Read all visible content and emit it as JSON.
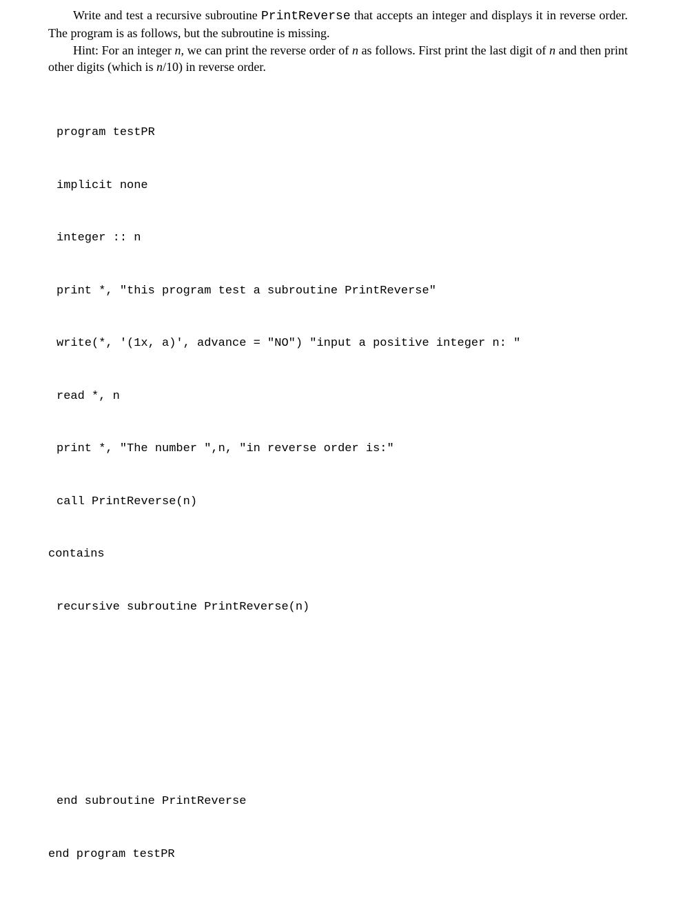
{
  "prose": {
    "p1_a": "Write and test a recursive subroutine ",
    "p1_code": "PrintReverse",
    "p1_b": " that accepts an integer and displays it in reverse order. The program is as follows, but the subroutine is missing.",
    "p2_a": "Hint: For an integer ",
    "p2_n1": "n",
    "p2_b": ", we can print the reverse order of ",
    "p2_n2": "n",
    "p2_c": " as follows. First print the last digit of ",
    "p2_n3": "n",
    "p2_d": " and then print other digits (which is ",
    "p2_n4": "n",
    "p2_e": "/10) in reverse order."
  },
  "code": {
    "l1": "program testPR",
    "l2": "implicit none",
    "l3": "integer :: n",
    "l4": "print *, \"this program test a subroutine PrintReverse\"",
    "l5": "write(*, '(1x, a)', advance = \"NO\") \"input a positive integer n: \"",
    "l6": "read *, n",
    "l7": "print *, \"The number \",n, \"in reverse order is:\"",
    "l8": "call PrintReverse(n)",
    "l9": "contains",
    "l10": "recursive subroutine PrintReverse(n)",
    "l11": "end subroutine PrintReverse",
    "l12": "end program testPR"
  }
}
